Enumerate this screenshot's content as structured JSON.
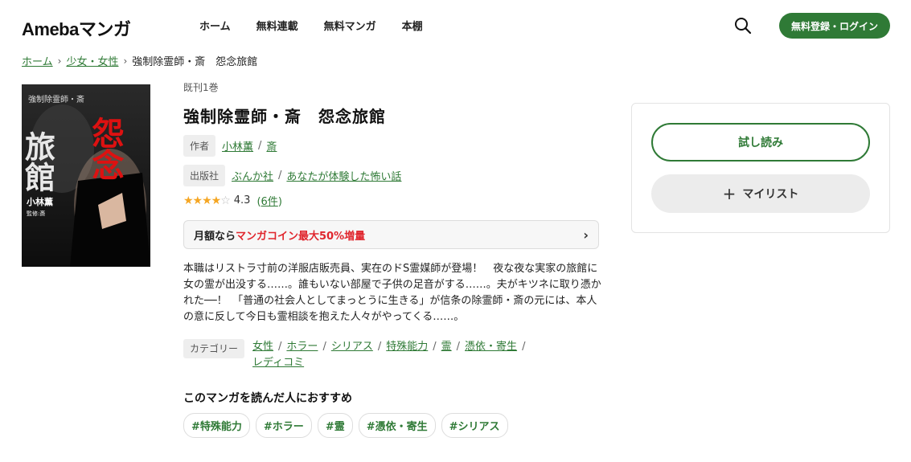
{
  "header": {
    "logo": "Amebaマンガ",
    "nav": [
      "ホーム",
      "無料連載",
      "無料マンガ",
      "本棚"
    ],
    "login_label": "無料登録・ログイン"
  },
  "breadcrumb": {
    "home": "ホーム",
    "category": "少女・女性",
    "current": "強制除霊師・斎　怨念旅館"
  },
  "book": {
    "status": "既刊1巻",
    "title": "強制除霊師・斎　怨念旅館",
    "author_label": "作者",
    "authors": [
      "小林薫",
      "斎"
    ],
    "publisher_label": "出版社",
    "publishers": [
      "ぶんか社",
      "あなたが体験した怖い話"
    ],
    "rating": 4.3,
    "rating_text": "4.3",
    "review_count": "6件",
    "cover_title_a": "怨念",
    "cover_title_b": "旅館",
    "cover_series": "強制除霊師・斎",
    "cover_author": "小林薫",
    "cover_supervisor": "監修:斎"
  },
  "promo": {
    "prefix": "月額なら",
    "highlight": "マンガコイン最大50%増量"
  },
  "description": "本職はリストラ寸前の洋服店販売員、実在のドS霊媒師が登場！　夜な夜な実家の旅館に女の霊が出没する……。誰もいない部屋で子供の足音がする……。夫がキツネに取り憑かれた──！　「普通の社会人としてまっとうに生きる」が信条の除霊師・斎の元には、本人の意に反して今日も霊相談を抱えた人々がやってくる……。",
  "categories": {
    "label": "カテゴリー",
    "items": [
      "女性",
      "ホラー",
      "シリアス",
      "特殊能力",
      "霊",
      "憑依・寄生",
      "レディコミ"
    ]
  },
  "recommend": {
    "title": "このマンガを読んだ人におすすめ",
    "tags": [
      "#特殊能力",
      "#ホラー",
      "#霊",
      "#憑依・寄生",
      "#シリアス"
    ]
  },
  "actions": {
    "try_label": "試し読み",
    "mylist_label": "マイリスト"
  },
  "colors": {
    "brand": "#2f7a36",
    "promo_red": "#e0262d",
    "star": "#f5a623"
  }
}
